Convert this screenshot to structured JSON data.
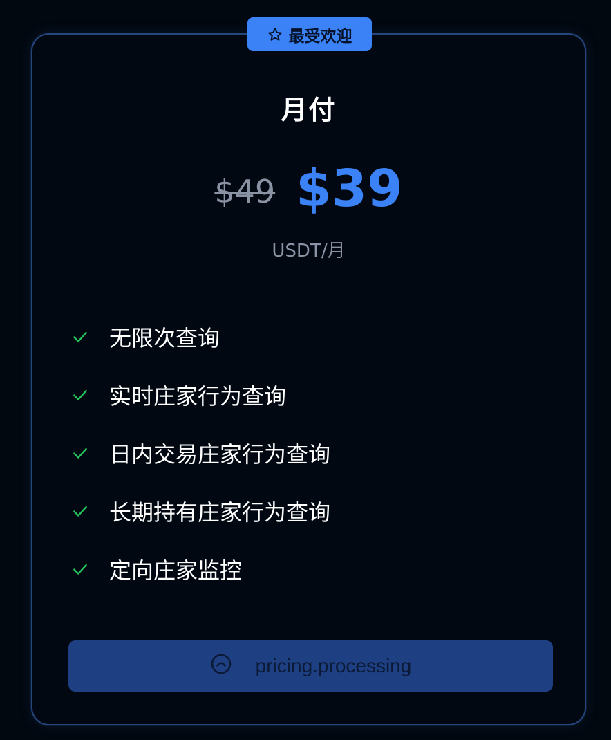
{
  "badge": {
    "icon": "star-outline-icon",
    "label": "最受欢迎"
  },
  "plan": {
    "title": "月付",
    "original_price": "$49",
    "price": "$39",
    "unit": "USDT/月"
  },
  "features": [
    "无限次查询",
    "实时庄家行为查询",
    "日内交易庄家行为查询",
    "长期持有庄家行为查询",
    "定向庄家监控"
  ],
  "cta": {
    "icon": "loading-spinner-icon",
    "label": "pricing.processing"
  },
  "colors": {
    "accent": "#3b82f6",
    "check": "#22c55e",
    "card_border": "#25477e",
    "button_bg": "#1e3f82",
    "background": "#020810"
  }
}
